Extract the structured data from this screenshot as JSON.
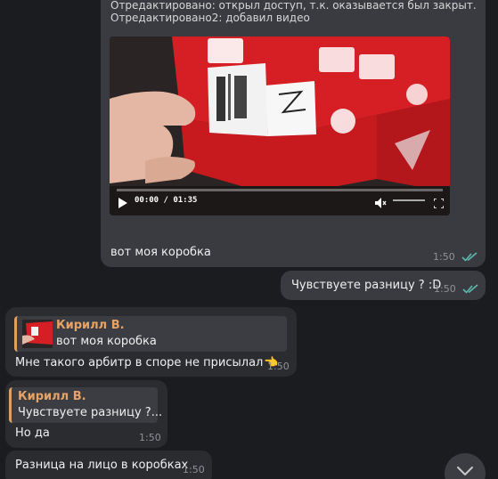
{
  "messages": {
    "video_msg": {
      "edit_line_1": "Отредактировано: открыл доступ, т.к. оказывается был закрыт.",
      "edit_line_2": "Отредактировано2: добавил видео",
      "video": {
        "time_display": "00:00 / 01:35",
        "progress": 0
      },
      "text": "вот моя коробка",
      "time": "1:50"
    },
    "out_msg": {
      "text": "Чувствуете разницу ? :D",
      "time": "1:50"
    },
    "reply1": {
      "quote_name": "Кирилл В.",
      "quote_text": "вот моя коробка",
      "text": "Мне такого арбитр в споре не присылал",
      "emoji": "👈",
      "time": "1:50"
    },
    "reply2": {
      "quote_name": "Кирилл В.",
      "quote_text": "Чувствуете разницу ?...",
      "text": "Но да",
      "time": "1:50"
    },
    "msg3": {
      "text": "Разница на лицо в коробках",
      "time": "1:50"
    }
  },
  "icons": {
    "read_check": "double-check-icon",
    "scroll_down": "chevron-down-icon",
    "play": "play-icon",
    "mute": "volume-muted-icon",
    "fullscreen": "fullscreen-icon"
  },
  "colors": {
    "background": "#1b1c1f",
    "incoming_bubble": "#2b2c30",
    "outgoing_bubble": "#393b40",
    "quote_accent": "#e7a366",
    "check": "#5fb8ae"
  }
}
